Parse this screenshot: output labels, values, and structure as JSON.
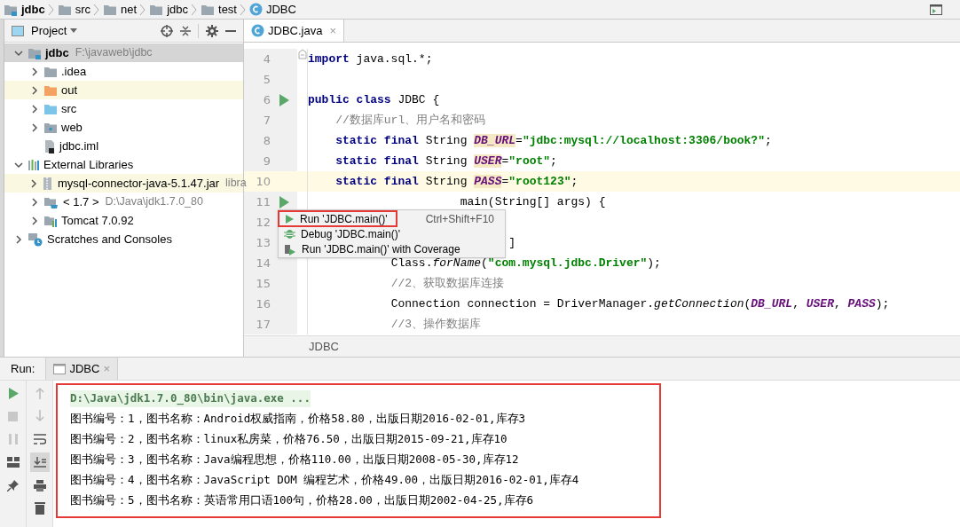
{
  "breadcrumbs": [
    {
      "label": "jdbc",
      "kind": "module"
    },
    {
      "label": "src",
      "kind": "folder"
    },
    {
      "label": "net",
      "kind": "package"
    },
    {
      "label": "jdbc",
      "kind": "package"
    },
    {
      "label": "test",
      "kind": "package"
    },
    {
      "label": "JDBC",
      "kind": "class"
    }
  ],
  "project": {
    "title": "Project",
    "tree": [
      {
        "label": "jdbc",
        "hint": "F:\\javaweb\\jdbc",
        "kind": "module",
        "expanded": true,
        "selected": true,
        "highlighted": false,
        "children": [
          {
            "label": ".idea",
            "kind": "folder",
            "expanded": false,
            "selected": false,
            "highlighted": false
          },
          {
            "label": "out",
            "kind": "folder-orange",
            "expanded": false,
            "selected": false,
            "highlighted": true
          },
          {
            "label": "src",
            "kind": "folder-blue",
            "expanded": false,
            "selected": false,
            "highlighted": false
          },
          {
            "label": "web",
            "kind": "folder-web",
            "expanded": false,
            "selected": false,
            "highlighted": false
          },
          {
            "label": "jdbc.iml",
            "kind": "file",
            "selected": false,
            "highlighted": false
          }
        ]
      },
      {
        "label": "External Libraries",
        "kind": "libraries",
        "expanded": true,
        "selected": false,
        "highlighted": false,
        "children": [
          {
            "label": "mysql-connector-java-5.1.47.jar",
            "hint": "libra",
            "kind": "jar",
            "expanded": false,
            "selected": false,
            "highlighted": true
          },
          {
            "label": "< 1.7 >",
            "hint": "D:\\Java\\jdk1.7.0_80",
            "kind": "jdk",
            "expanded": false,
            "selected": false,
            "highlighted": false
          },
          {
            "label": "Tomcat 7.0.92",
            "kind": "tomcat",
            "expanded": false,
            "selected": false,
            "highlighted": false
          }
        ]
      },
      {
        "label": "Scratches and Consoles",
        "kind": "scratch",
        "expanded": false,
        "selected": false,
        "highlighted": false
      }
    ]
  },
  "editor": {
    "tab": {
      "label": "JDBC.java",
      "close": "×"
    },
    "footer": "JDBC",
    "lines": [
      {
        "num": "4",
        "kind": "fold",
        "current": false,
        "tokens": [
          {
            "kind": "kw",
            "text": "import"
          },
          {
            "kind": "plain",
            "text": " java.sql.*;"
          }
        ]
      },
      {
        "num": "5",
        "kind": "plain",
        "current": false
      },
      {
        "num": "6",
        "kind": "run",
        "current": false,
        "tokens": [
          {
            "kind": "kw",
            "text": "public class"
          },
          {
            "kind": "plain",
            "text": " JDBC {"
          }
        ]
      },
      {
        "num": "7",
        "kind": "plain",
        "current": false,
        "tokens": [
          {
            "kind": "comment",
            "text": "    //数据库url、用户名和密码"
          }
        ]
      },
      {
        "num": "8",
        "kind": "plain",
        "current": false,
        "tokens": [
          {
            "kind": "kw",
            "text": "    static final"
          },
          {
            "kind": "plain",
            "text": " String "
          },
          {
            "kind": "field-decl",
            "text": "DB_URL"
          },
          {
            "kind": "plain",
            "text": "="
          },
          {
            "kind": "str",
            "text": "\"jdbc:mysql://localhost:3306/book?\""
          },
          {
            "kind": "plain",
            "text": ";"
          }
        ]
      },
      {
        "num": "9",
        "kind": "plain",
        "current": false,
        "tokens": [
          {
            "kind": "kw",
            "text": "    static final"
          },
          {
            "kind": "plain",
            "text": " String "
          },
          {
            "kind": "field-decl",
            "text": "USER"
          },
          {
            "kind": "plain",
            "text": "="
          },
          {
            "kind": "str",
            "text": "\"root\""
          },
          {
            "kind": "plain",
            "text": ";"
          }
        ]
      },
      {
        "num": "10",
        "kind": "plain",
        "current": true,
        "tokens": [
          {
            "kind": "kw",
            "text": "    static final"
          },
          {
            "kind": "plain",
            "text": " String "
          },
          {
            "kind": "field-decl",
            "text": "PASS"
          },
          {
            "kind": "plain",
            "text": "="
          },
          {
            "kind": "str",
            "text": "\"root123\""
          },
          {
            "kind": "plain",
            "text": ";"
          }
        ]
      },
      {
        "num": "11",
        "kind": "run",
        "current": false,
        "tokens": [
          {
            "kind": "plain",
            "text": "                      main(String[] args) {"
          }
        ]
      },
      {
        "num": "12",
        "kind": "plain",
        "current": false
      },
      {
        "num": "13",
        "kind": "plain",
        "current": false,
        "tokens": [
          {
            "kind": "plain",
            "text": "                             ]"
          }
        ]
      },
      {
        "num": "14",
        "kind": "plain",
        "current": false,
        "tokens": [
          {
            "kind": "plain",
            "text": "            Class."
          },
          {
            "kind": "method",
            "text": "forName"
          },
          {
            "kind": "plain",
            "text": "("
          },
          {
            "kind": "str",
            "text": "\"com.mysql.jdbc.Driver\""
          },
          {
            "kind": "plain",
            "text": ");"
          }
        ]
      },
      {
        "num": "15",
        "kind": "plain",
        "current": false,
        "tokens": [
          {
            "kind": "comment",
            "text": "            //2、获取数据库连接"
          }
        ]
      },
      {
        "num": "16",
        "kind": "plain",
        "current": false,
        "tokens": [
          {
            "kind": "plain",
            "text": "            Connection connection = DriverManager."
          },
          {
            "kind": "method",
            "text": "getConnection"
          },
          {
            "kind": "plain",
            "text": "("
          },
          {
            "kind": "field",
            "text": "DB_URL"
          },
          {
            "kind": "plain",
            "text": ", "
          },
          {
            "kind": "field",
            "text": "USER"
          },
          {
            "kind": "plain",
            "text": ", "
          },
          {
            "kind": "field",
            "text": "PASS"
          },
          {
            "kind": "plain",
            "text": ");"
          }
        ]
      },
      {
        "num": "17",
        "kind": "plain",
        "current": false,
        "tokens": [
          {
            "kind": "comment",
            "text": "            //3、操作数据库"
          }
        ]
      }
    ]
  },
  "popup": {
    "items": [
      {
        "label": "Run 'JDBC.main()'",
        "shortcut": "Ctrl+Shift+F10",
        "kind": "run",
        "selected": true
      },
      {
        "label": "Debug 'JDBC.main()'",
        "kind": "debug",
        "selected": false
      },
      {
        "label": "Run 'JDBC.main()' with Coverage",
        "kind": "coverage",
        "selected": false
      }
    ]
  },
  "run": {
    "label": "Run:",
    "tab": {
      "label": "JDBC",
      "close": "×"
    },
    "console": [
      {
        "kind": "command",
        "text": "D:\\Java\\jdk1.7.0_80\\bin\\java.exe ..."
      },
      {
        "kind": "output",
        "text": "图书编号：1，图书名称：Android权威指南，价格58.80，出版日期2016-02-01,库存3"
      },
      {
        "kind": "output",
        "text": "图书编号：2，图书名称：linux私房菜，价格76.50，出版日期2015-09-21,库存10"
      },
      {
        "kind": "output",
        "text": "图书编号：3，图书名称：Java编程思想，价格110.00，出版日期2008-05-30,库存12"
      },
      {
        "kind": "output",
        "text": "图书编号：4，图书名称：JavaScript DOM 编程艺术，价格49.00，出版日期2016-02-01,库存4"
      },
      {
        "kind": "output",
        "text": "图书编号：5，图书名称：英语常用口语100句，价格28.00，出版日期2002-04-25,库存6"
      }
    ]
  }
}
